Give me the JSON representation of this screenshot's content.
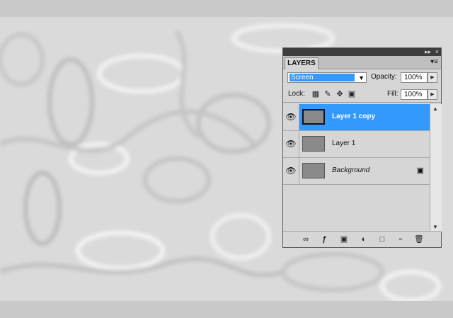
{
  "panel": {
    "tab_label": "LAYERS",
    "collapse_icon": "double-chevron-right-icon",
    "menu_icon": "panel-menu-icon"
  },
  "blend": {
    "value": "Screen"
  },
  "opacity": {
    "label": "Opacity:",
    "value": "100%"
  },
  "lock": {
    "label": "Lock:",
    "icons": [
      "lock-transparent-icon",
      "lock-paint-icon",
      "lock-move-icon",
      "lock-all-icon"
    ]
  },
  "fill": {
    "label": "Fill:",
    "value": "100%"
  },
  "layers": [
    {
      "name": "Layer 1 copy",
      "selected": true,
      "visible": true,
      "italic": false,
      "locked": false
    },
    {
      "name": "Layer 1",
      "selected": false,
      "visible": true,
      "italic": false,
      "locked": false
    },
    {
      "name": "Background",
      "selected": false,
      "visible": true,
      "italic": true,
      "locked": true
    }
  ],
  "footer_buttons": [
    "link-layers-icon",
    "fx-icon",
    "add-mask-icon",
    "adjustment-layer-icon",
    "new-group-icon",
    "new-layer-icon",
    "trash-icon"
  ],
  "colors": {
    "selection": "#3399ff",
    "titlebar": "#3d3d3d",
    "panel": "#d6d6d6"
  }
}
